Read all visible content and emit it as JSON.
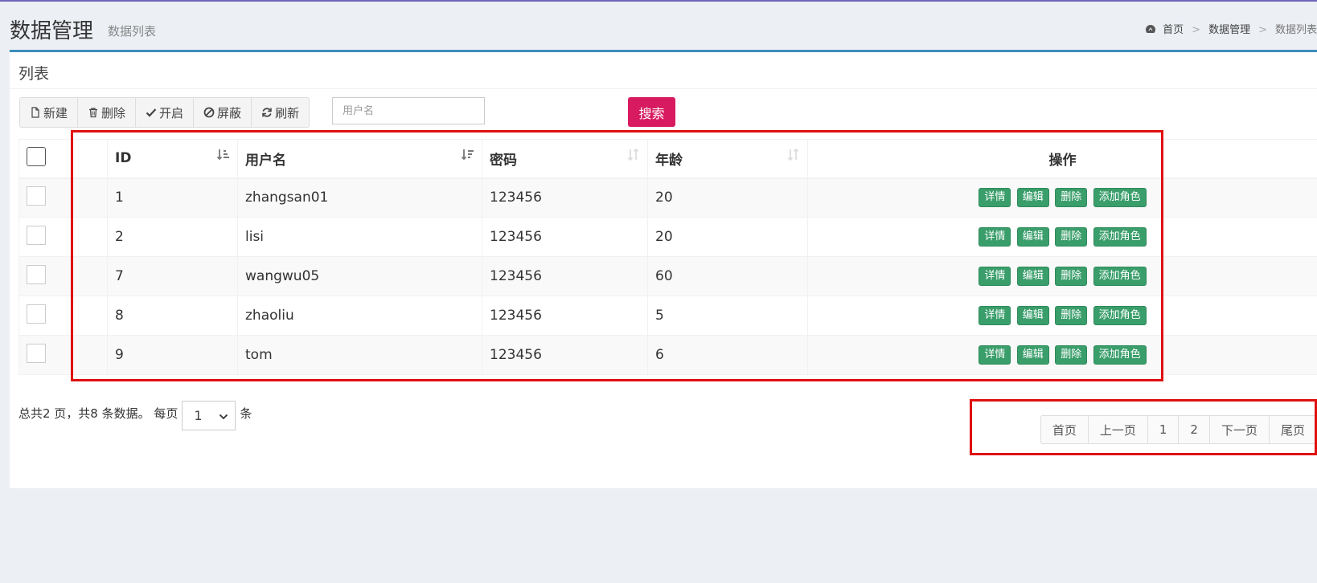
{
  "header": {
    "title": "数据管理",
    "subtitle": "数据列表",
    "breadcrumb": [
      "首页",
      "数据管理",
      "数据列表"
    ]
  },
  "box": {
    "title": "列表"
  },
  "toolbar": {
    "buttons": [
      {
        "label": "新建",
        "icon": "file-icon"
      },
      {
        "label": "删除",
        "icon": "trash-icon"
      },
      {
        "label": "开启",
        "icon": "check-icon"
      },
      {
        "label": "屏蔽",
        "icon": "ban-icon"
      },
      {
        "label": "刷新",
        "icon": "refresh-icon"
      }
    ],
    "search_placeholder": "用户名",
    "search_label": "搜索"
  },
  "table": {
    "columns": [
      "ID",
      "用户名",
      "密码",
      "年龄",
      "操作"
    ],
    "rows": [
      {
        "id": "1",
        "username": "zhangsan01",
        "password": "123456",
        "age": "20"
      },
      {
        "id": "2",
        "username": "lisi",
        "password": "123456",
        "age": "20"
      },
      {
        "id": "7",
        "username": "wangwu05",
        "password": "123456",
        "age": "60"
      },
      {
        "id": "8",
        "username": "zhaoliu",
        "password": "123456",
        "age": "5"
      },
      {
        "id": "9",
        "username": "tom",
        "password": "123456",
        "age": "6"
      }
    ],
    "row_actions": [
      "详情",
      "编辑",
      "删除",
      "添加角色"
    ]
  },
  "pagination": {
    "summary": "总共2 页，共8 条数据。 每页",
    "page_size": "1",
    "suffix": "条",
    "links": [
      "首页",
      "上一页",
      "1",
      "2",
      "下一页",
      "尾页"
    ]
  },
  "colors": {
    "accent": "#3c8dbc",
    "search_button": "#d81b60",
    "action_button": "#3a9e6b",
    "highlight": "#e01010"
  }
}
